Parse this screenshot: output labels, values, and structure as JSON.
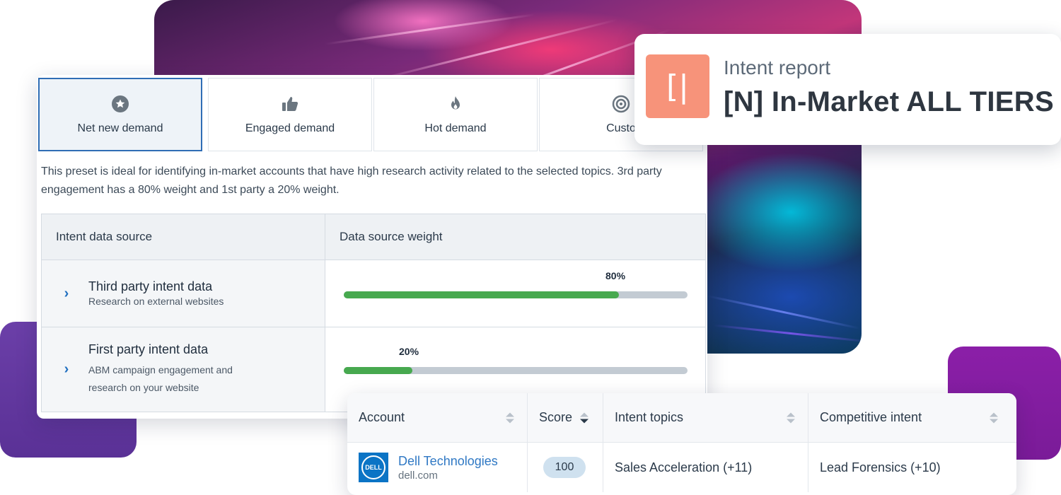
{
  "colors": {
    "active_tab_border": "#2f6db5",
    "bar_fill": "#47a94f",
    "bar_track": "#c3cbd3",
    "link": "#2f78c4",
    "report_logo": "#f7937a",
    "score_pill": "#cfe1ef"
  },
  "tabs": [
    {
      "label": "Net new demand",
      "icon": "star-circle-icon",
      "active": true
    },
    {
      "label": "Engaged demand",
      "icon": "thumbs-up-icon",
      "active": false
    },
    {
      "label": "Hot demand",
      "icon": "flame-icon",
      "active": false
    },
    {
      "label": "Custo",
      "icon": "target-icon",
      "active": false
    }
  ],
  "preset": {
    "description": "This preset is ideal for identifying in-market accounts that have high research activity related to the selected topics. 3rd party engagement has a 80% weight and 1st party a 20% weight."
  },
  "weights_table": {
    "headers": {
      "source": "Intent data source",
      "weight": "Data source weight"
    },
    "rows": [
      {
        "title": "Third party intent data",
        "subtitle": "Research on external websites",
        "weight_label": "80%",
        "weight": 0.8
      },
      {
        "title": "First party intent data",
        "subtitle": "ABM campaign engagement and research on your website",
        "weight_label": "20%",
        "weight": 0.2
      }
    ]
  },
  "report": {
    "logo_glyph": "[|",
    "label": "Intent report",
    "name": "[N] In-Market ALL TIERS"
  },
  "accounts_table": {
    "headers": {
      "account": "Account",
      "score": "Score",
      "topics": "Intent topics",
      "competitive": "Competitive intent"
    },
    "rows": [
      {
        "logo_text": "DELL",
        "company": "Dell Technologies",
        "domain": "dell.com",
        "score": "100",
        "topics": "Sales Acceleration (+11)",
        "competitive": "Lead Forensics (+10)"
      }
    ]
  }
}
